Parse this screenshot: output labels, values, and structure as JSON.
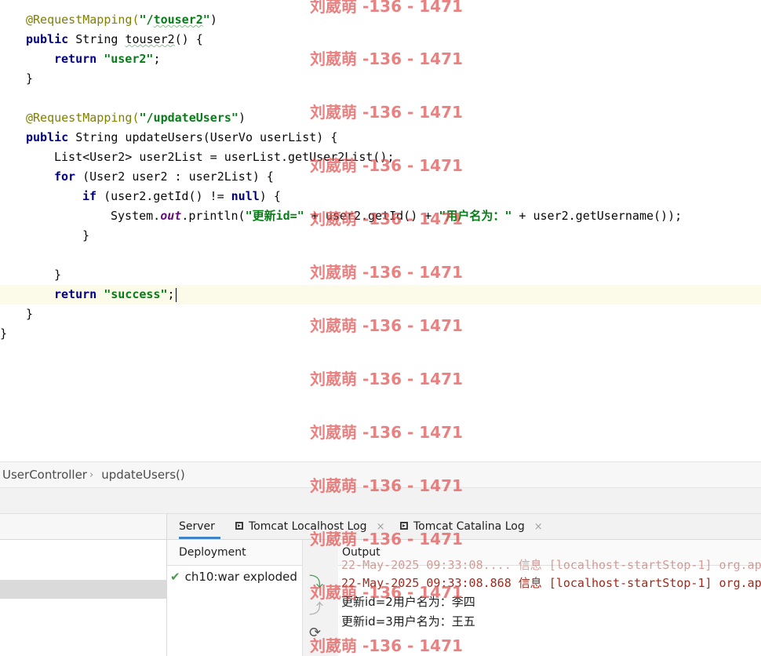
{
  "editor": {
    "l1": {
      "ann": "@RequestMapping(",
      "s1": "\"/",
      "sq": "touser2",
      "s2": "\"",
      "close": ")"
    },
    "l2": {
      "kw": "public",
      "rest": " String ",
      "method": "touser2",
      "tail": "() {"
    },
    "l3": {
      "kw": "return",
      "sp": " ",
      "str": "\"user2\"",
      "tail": ";"
    },
    "l4": {
      "text": "}"
    },
    "l6": {
      "ann": "@RequestMapping(",
      "str": "\"/updateUsers\"",
      "close": ")"
    },
    "l7": {
      "kw": "public",
      "rest": " String updateUsers(UserVo userList) {"
    },
    "l8": {
      "text": "List<User2> user2List = userList.getUser2List();"
    },
    "l9": {
      "kw": "for",
      "rest": " (User2 user2 : user2List) {"
    },
    "l10": {
      "kw": "if",
      "mid": " (user2.getId() != ",
      "kw2": "null",
      "tail": ") {"
    },
    "l11": {
      "pre": "System.",
      "fld": "out",
      "mid": ".println(",
      "str1": "\"更新id=\"",
      "mid2": " + user2.getId() + ",
      "str2": "\"用户名为：\"",
      "tail": " + user2.getUsername());"
    },
    "l12": {
      "text": "}"
    },
    "l14": {
      "text": "}"
    },
    "l15": {
      "kw": "return",
      "sp": " ",
      "str": "\"success\"",
      "tail": ";"
    },
    "l16": {
      "text": "}"
    },
    "l17": {
      "text": "}"
    }
  },
  "breadcrumb": {
    "items": [
      "UserController",
      "updateUsers()"
    ],
    "separator": "›"
  },
  "services": {
    "tabs": [
      {
        "label": "Server",
        "active": true
      },
      {
        "label": "Tomcat Localhost Log",
        "close": "×"
      },
      {
        "label": "Tomcat Catalina Log",
        "close": "×"
      }
    ],
    "deployment_header": "Deployment",
    "deployment_item": "ch10:war exploded",
    "output_header": "Output",
    "output_lines": [
      "22-May-2025 09:33:08.868 信息 [localhost-startStop-1] org.ap",
      "更新id=2用户名为：李四",
      "更新id=3用户名为：王五"
    ],
    "output_partial": "22-May-2025 09:33:08.... 信息 [localhost-startStop-1] org.ap"
  },
  "watermark": "刘葳萌 -136 - 1471",
  "colors": {
    "keyword": "#000080",
    "string": "#067d17",
    "annotation": "#808000",
    "watermark": "#e05050",
    "tab_accent": "#4083c9"
  }
}
